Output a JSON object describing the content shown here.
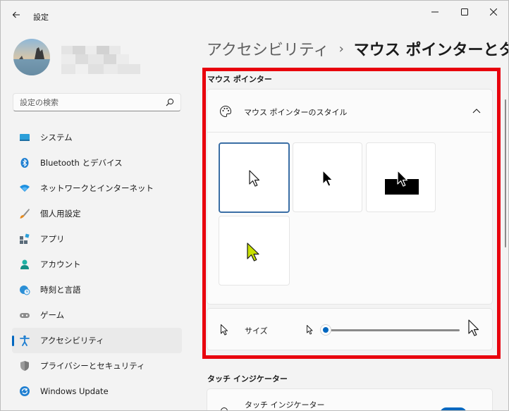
{
  "window": {
    "title": "設定"
  },
  "search": {
    "placeholder": "設定の検索"
  },
  "sidebar": {
    "items": [
      {
        "label": "システム",
        "icon": "system-icon"
      },
      {
        "label": "Bluetooth とデバイス",
        "icon": "bluetooth-icon"
      },
      {
        "label": "ネットワークとインターネット",
        "icon": "network-icon"
      },
      {
        "label": "個人用設定",
        "icon": "brush-icon"
      },
      {
        "label": "アプリ",
        "icon": "apps-icon"
      },
      {
        "label": "アカウント",
        "icon": "account-icon"
      },
      {
        "label": "時刻と言語",
        "icon": "time-language-icon"
      },
      {
        "label": "ゲーム",
        "icon": "gaming-icon"
      },
      {
        "label": "アクセシビリティ",
        "icon": "accessibility-icon",
        "active": true
      },
      {
        "label": "プライバシーとセキュリティ",
        "icon": "shield-icon"
      },
      {
        "label": "Windows Update",
        "icon": "windows-update-icon"
      }
    ]
  },
  "header": {
    "parent": "アクセシビリティ",
    "separator": "›",
    "current": "マウス ポインターとタッチ"
  },
  "main": {
    "mouse_pointer_section": "マウス ポインター",
    "style_card_label": "マウス ポインターのスタイル",
    "size_label": "サイズ",
    "size_value": 0,
    "touch_section": "タッチ インジケーター",
    "touch_row_label": "タッチ インジケーター"
  },
  "colors": {
    "accent": "#0067c0",
    "highlight": "#e8000d",
    "custom_pointer": "#c8e000"
  }
}
